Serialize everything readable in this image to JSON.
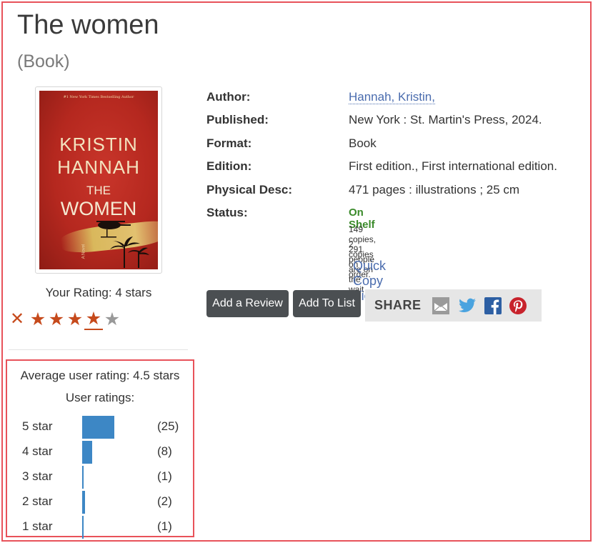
{
  "book": {
    "title": "The women",
    "format_label": "(Book)",
    "cover": {
      "tagline": "#1 New York Times Bestselling Author",
      "author_line1": "KRISTIN",
      "author_line2": "HANNAH",
      "title_small": "THE",
      "title_large": "WOMEN",
      "novel": "A Novel"
    }
  },
  "rating": {
    "your_rating_text": "Your Rating: 4 stars",
    "your_rating_value": 4,
    "max_stars": 5
  },
  "average": {
    "title": "Average user rating: 4.5 stars",
    "ratings_title": "User ratings:",
    "rows": [
      {
        "label": "5 star",
        "count": "(25)",
        "n": 25
      },
      {
        "label": "4 star",
        "count": "(8)",
        "n": 8
      },
      {
        "label": "3 star",
        "count": "(1)",
        "n": 1
      },
      {
        "label": "2 star",
        "count": "(2)",
        "n": 2
      },
      {
        "label": "1 star",
        "count": "(1)",
        "n": 1
      }
    ]
  },
  "details": {
    "rows": [
      {
        "key": "Author:",
        "value": "Hannah, Kristin,"
      },
      {
        "key": "Published:",
        "value": "New York : St. Martin's Press, 2024."
      },
      {
        "key": "Format:",
        "value": "Book"
      },
      {
        "key": "Edition:",
        "value": "First edition., First international edition."
      },
      {
        "key": "Physical Desc:",
        "value": "471 pages : illustrations ; 25 cm"
      },
      {
        "key": "Status:",
        "value": ""
      }
    ],
    "status": "On Shelf",
    "copies": "149 copies, 291 people are on the wait list.",
    "on_order": "2 copies on order.",
    "quick_copy": "Quick Copy View"
  },
  "actions": {
    "add_review": "Add a Review",
    "add_to_list": "Add To List",
    "share_label": "SHARE",
    "share_icons": [
      "email-icon",
      "twitter-icon",
      "facebook-icon",
      "pinterest-icon"
    ]
  },
  "colors": {
    "accent_red": "#e8525a",
    "star": "#c64a1c",
    "bar": "#3d87c5",
    "link": "#4a6cae",
    "status_green": "#3a8a2a"
  }
}
